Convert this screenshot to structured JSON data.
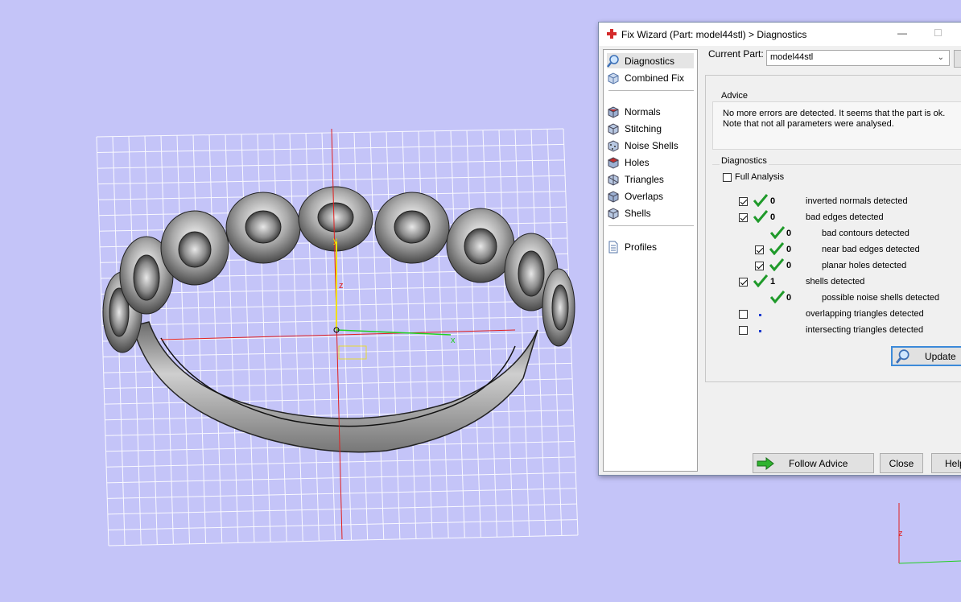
{
  "dialog": {
    "title": "Fix Wizard (Part: model44stl) > Diagnostics",
    "minimize_glyph": "—",
    "maximize_glyph": "☐"
  },
  "nav": {
    "items": [
      {
        "label": "Diagnostics",
        "icon": "diagnostics-magnifier-icon"
      },
      {
        "label": "Combined Fix",
        "icon": "combined-fix-cube-icon"
      },
      {
        "label": "Normals",
        "icon": "normals-cube-icon"
      },
      {
        "label": "Stitching",
        "icon": "stitching-cube-icon"
      },
      {
        "label": "Noise Shells",
        "icon": "noise-shells-icon"
      },
      {
        "label": "Holes",
        "icon": "holes-cube-icon"
      },
      {
        "label": "Triangles",
        "icon": "triangles-cube-icon"
      },
      {
        "label": "Overlaps",
        "icon": "overlaps-cube-icon"
      },
      {
        "label": "Shells",
        "icon": "shells-cube-icon"
      },
      {
        "label": "Profiles",
        "icon": "profiles-document-icon"
      }
    ]
  },
  "current_part": {
    "label": "Current Part:",
    "value": "model44stl"
  },
  "advice": {
    "label": "Advice",
    "text": "No more errors are detected. It seems that the part is ok.\nNote that not all parameters were analysed."
  },
  "diagnostics": {
    "label": "Diagnostics",
    "full_analysis": "Full Analysis",
    "rows": [
      {
        "count": "0",
        "label": "inverted normals detected"
      },
      {
        "count": "0",
        "label": "bad edges detected"
      },
      {
        "count": "0",
        "label": "bad contours detected"
      },
      {
        "count": "0",
        "label": "near bad edges detected"
      },
      {
        "count": "0",
        "label": "planar holes detected"
      },
      {
        "count": "1",
        "label": "shells detected"
      },
      {
        "count": "0",
        "label": "possible noise shells detected"
      },
      {
        "count": "",
        "label": "overlapping triangles detected"
      },
      {
        "count": "",
        "label": "intersecting triangles detected"
      }
    ]
  },
  "buttons": {
    "update": "Update",
    "follow_advice": "Follow Advice",
    "close": "Close",
    "help": "Help"
  },
  "viewport": {
    "axis_z": "z",
    "axis_x": "x",
    "axis_y": "y",
    "background": "#c4c4f8"
  }
}
